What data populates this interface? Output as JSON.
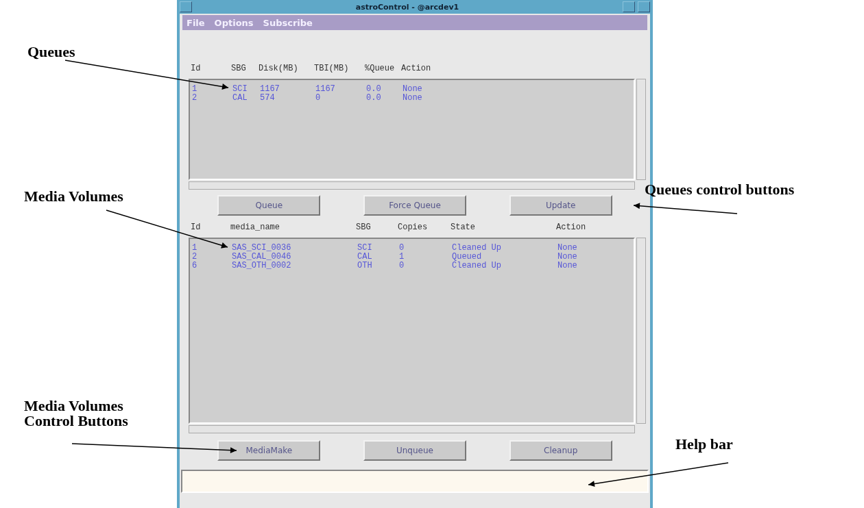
{
  "window": {
    "title": "astroControl - @arcdev1"
  },
  "menu": [
    "File",
    "Options",
    "Subscribe"
  ],
  "queues": {
    "columns": [
      "Id",
      "SBG",
      "Disk(MB)",
      "TBI(MB)",
      "%Queue",
      "Action"
    ],
    "rows": [
      [
        "1",
        "SCI",
        "1167",
        "1167",
        "0.0",
        "None"
      ],
      [
        "2",
        "CAL",
        "574",
        "0",
        "0.0",
        "None"
      ]
    ],
    "buttons": [
      "Queue",
      "Force Queue",
      "Update"
    ]
  },
  "media_volumes": {
    "columns": [
      "Id",
      "media_name",
      "SBG",
      "Copies",
      "State",
      "Action"
    ],
    "rows": [
      [
        "1",
        "SAS_SCI_0036",
        "SCI",
        "0",
        "Cleaned Up",
        "None"
      ],
      [
        "2",
        "SAS_CAL_0046",
        "CAL",
        "1",
        "Queued",
        "None"
      ],
      [
        "6",
        "SAS_OTH_0002",
        "OTH",
        "0",
        "Cleaned Up",
        "None"
      ]
    ],
    "buttons": [
      "MediaMake",
      "Unqueue",
      "Cleanup"
    ]
  },
  "annotations": [
    {
      "lines": [
        "Queues"
      ]
    },
    {
      "lines": [
        "Media Volumes"
      ]
    },
    {
      "lines": [
        "Queues control buttons"
      ]
    },
    {
      "lines": [
        "Media Volumes",
        "Control Buttons"
      ]
    },
    {
      "lines": [
        "Help bar"
      ]
    }
  ]
}
